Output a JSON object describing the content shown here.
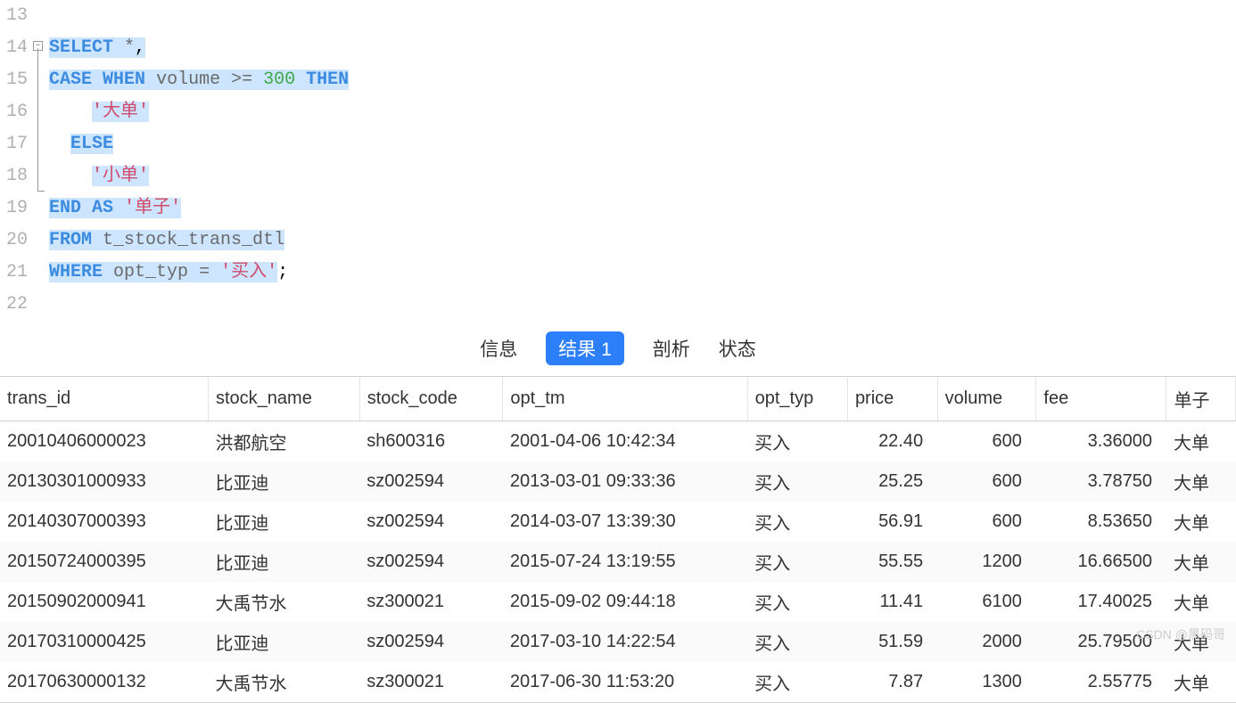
{
  "editor": {
    "lines": [
      {
        "n": "13",
        "tokens": []
      },
      {
        "n": "14",
        "tokens": [
          {
            "t": "SELECT",
            "c": "kw",
            "s": true
          },
          {
            "t": " ",
            "s": true
          },
          {
            "t": "*",
            "c": "op",
            "s": true
          },
          {
            "t": ",",
            "s": true
          }
        ]
      },
      {
        "n": "15",
        "tokens": [
          {
            "t": "CASE",
            "c": "kw",
            "s": true
          },
          {
            "t": " ",
            "s": true
          },
          {
            "t": "WHEN",
            "c": "kw",
            "s": true
          },
          {
            "t": " ",
            "s": true
          },
          {
            "t": "volume",
            "c": "ident",
            "s": true
          },
          {
            "t": " ",
            "s": true
          },
          {
            "t": ">=",
            "c": "op",
            "s": true
          },
          {
            "t": " ",
            "s": true
          },
          {
            "t": "300",
            "c": "num",
            "s": true
          },
          {
            "t": " ",
            "s": true
          },
          {
            "t": "THEN",
            "c": "kw",
            "s": true
          }
        ]
      },
      {
        "n": "16",
        "indent": "    ",
        "tokens": [
          {
            "t": "'大单'",
            "c": "str",
            "s": true
          }
        ]
      },
      {
        "n": "17",
        "indent": "  ",
        "tokens": [
          {
            "t": "ELSE",
            "c": "kw",
            "s": true
          }
        ]
      },
      {
        "n": "18",
        "indent": "    ",
        "tokens": [
          {
            "t": "'小单'",
            "c": "str",
            "s": true
          }
        ]
      },
      {
        "n": "19",
        "tokens": [
          {
            "t": "END",
            "c": "kw",
            "s": true
          },
          {
            "t": " ",
            "s": true
          },
          {
            "t": "AS",
            "c": "kw",
            "s": true
          },
          {
            "t": " ",
            "s": true
          },
          {
            "t": "'单子'",
            "c": "str",
            "s": true
          }
        ]
      },
      {
        "n": "20",
        "tokens": [
          {
            "t": "FROM",
            "c": "kw",
            "s": true
          },
          {
            "t": " ",
            "s": true
          },
          {
            "t": "t_stock_trans_dtl",
            "c": "ident",
            "s": true
          }
        ]
      },
      {
        "n": "21",
        "tokens": [
          {
            "t": "WHERE",
            "c": "kw",
            "s": true
          },
          {
            "t": " ",
            "s": true
          },
          {
            "t": "opt_typ",
            "c": "ident",
            "s": true
          },
          {
            "t": " ",
            "s": true
          },
          {
            "t": "=",
            "c": "op",
            "s": true
          },
          {
            "t": " ",
            "s": true
          },
          {
            "t": "'买入'",
            "c": "str",
            "s": true
          },
          {
            "t": ";"
          }
        ]
      },
      {
        "n": "22",
        "tokens": []
      }
    ]
  },
  "tabs": {
    "info": "信息",
    "result": "结果 1",
    "profile": "剖析",
    "status": "状态"
  },
  "table": {
    "headers": [
      "trans_id",
      "stock_name",
      "stock_code",
      "opt_tm",
      "opt_typ",
      "price",
      "volume",
      "fee",
      "单子"
    ],
    "num_cols": [
      5,
      6,
      7
    ],
    "rows": [
      [
        "20010406000023",
        "洪都航空",
        "sh600316",
        "2001-04-06 10:42:34",
        "买入",
        "22.40",
        "600",
        "3.36000",
        "大单"
      ],
      [
        "20130301000933",
        "比亚迪",
        "sz002594",
        "2013-03-01 09:33:36",
        "买入",
        "25.25",
        "600",
        "3.78750",
        "大单"
      ],
      [
        "20140307000393",
        "比亚迪",
        "sz002594",
        "2014-03-07 13:39:30",
        "买入",
        "56.91",
        "600",
        "8.53650",
        "大单"
      ],
      [
        "20150724000395",
        "比亚迪",
        "sz002594",
        "2015-07-24 13:19:55",
        "买入",
        "55.55",
        "1200",
        "16.66500",
        "大单"
      ],
      [
        "20150902000941",
        "大禹节水",
        "sz300021",
        "2015-09-02 09:44:18",
        "买入",
        "11.41",
        "6100",
        "17.40025",
        "大单"
      ],
      [
        "20170310000425",
        "比亚迪",
        "sz002594",
        "2017-03-10 14:22:54",
        "买入",
        "51.59",
        "2000",
        "25.79500",
        "大单"
      ],
      [
        "20170630000132",
        "大禹节水",
        "sz300021",
        "2017-06-30 11:53:20",
        "买入",
        "7.87",
        "1300",
        "2.55775",
        "大单"
      ]
    ]
  },
  "watermark": "CSDN @黑码哥"
}
